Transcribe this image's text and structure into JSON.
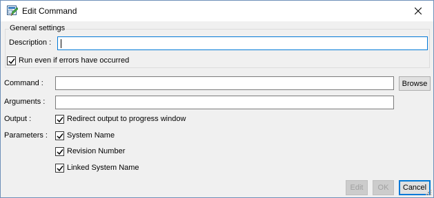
{
  "window": {
    "title": "Edit Command",
    "icon": "edit-command-app-icon",
    "close_icon": "close-icon"
  },
  "general": {
    "group_label": "General settings",
    "description_label": "Description :",
    "description_value": "",
    "run_even_if_errors_label": "Run even if errors have occurred",
    "run_even_if_errors_checked": true
  },
  "command": {
    "label": "Command :",
    "value": "",
    "browse_label": "Browse"
  },
  "arguments": {
    "label": "Arguments :",
    "value": ""
  },
  "output": {
    "label": "Output :",
    "redirect_label": "Redirect output to progress window",
    "redirect_checked": true
  },
  "parameters": {
    "label": "Parameters :",
    "items": [
      {
        "label": "System Name",
        "checked": true
      },
      {
        "label": "Revision Number",
        "checked": true
      },
      {
        "label": "Linked System Name",
        "checked": true
      }
    ]
  },
  "buttons": {
    "edit": "Edit",
    "ok": "OK",
    "cancel": "Cancel"
  },
  "colors": {
    "focus": "#0078d7",
    "window_bg": "#f0f0f0",
    "title_bg": "#ffffff"
  }
}
